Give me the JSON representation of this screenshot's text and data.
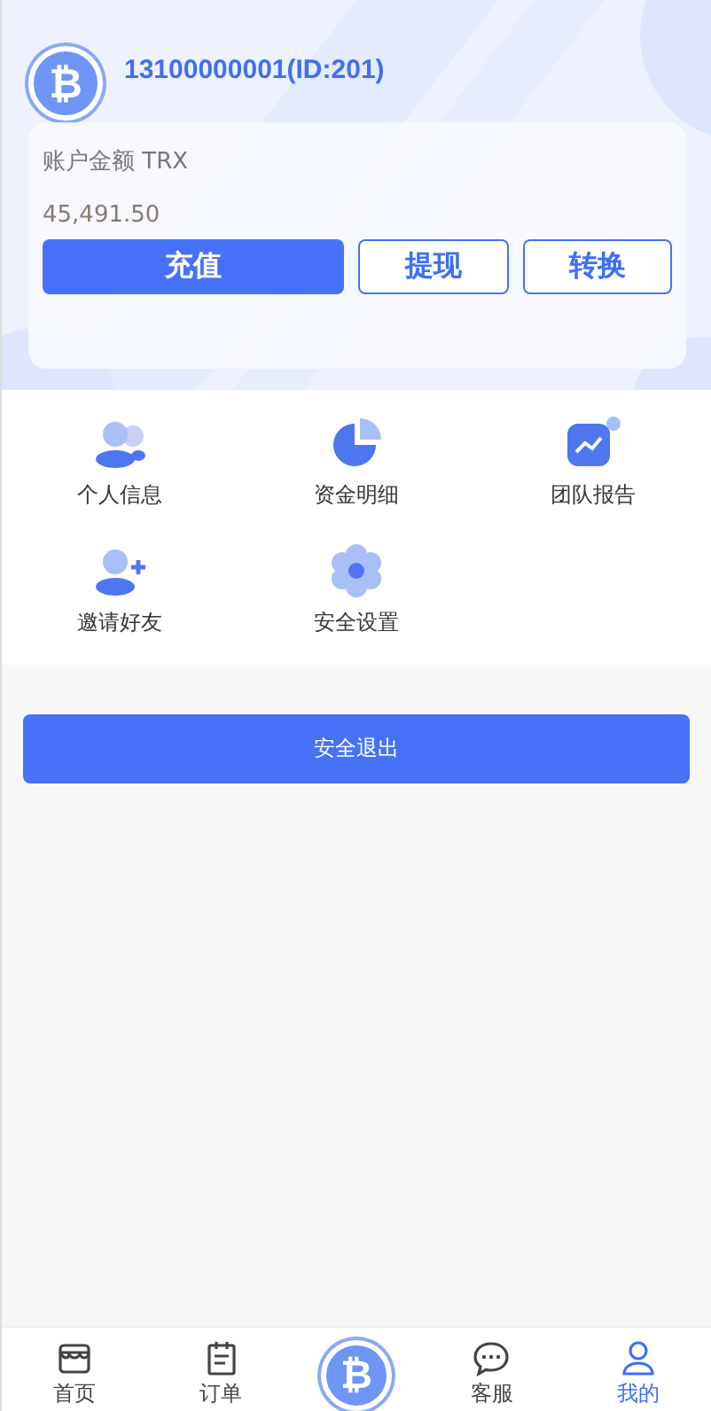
{
  "profile": {
    "avatar_symbol": "₿",
    "username": "13100000001(ID:201)"
  },
  "balance": {
    "label": "账户金额 TRX",
    "amount": "45,491.50"
  },
  "actions": [
    {
      "label": "充值",
      "kind": "primary"
    },
    {
      "label": "提现",
      "kind": "outline"
    },
    {
      "label": "转换",
      "kind": "outline"
    }
  ],
  "menu": [
    {
      "label": "个人信息",
      "kind": "users"
    },
    {
      "label": "资金明细",
      "kind": "pie"
    },
    {
      "label": "团队报告",
      "kind": "chart"
    },
    {
      "label": "邀请好友",
      "kind": "invite"
    },
    {
      "label": "安全设置",
      "kind": "gear"
    }
  ],
  "logout": {
    "label": "安全退出"
  },
  "tabbar": [
    {
      "kind": "home",
      "label": "首页",
      "selected": false
    },
    {
      "kind": "orders",
      "label": "订单",
      "selected": false
    },
    {
      "kind": "coin",
      "symbol": "₿"
    },
    {
      "kind": "chat",
      "label": "客服",
      "selected": false
    },
    {
      "kind": "user",
      "label": "我的",
      "selected": true
    }
  ]
}
